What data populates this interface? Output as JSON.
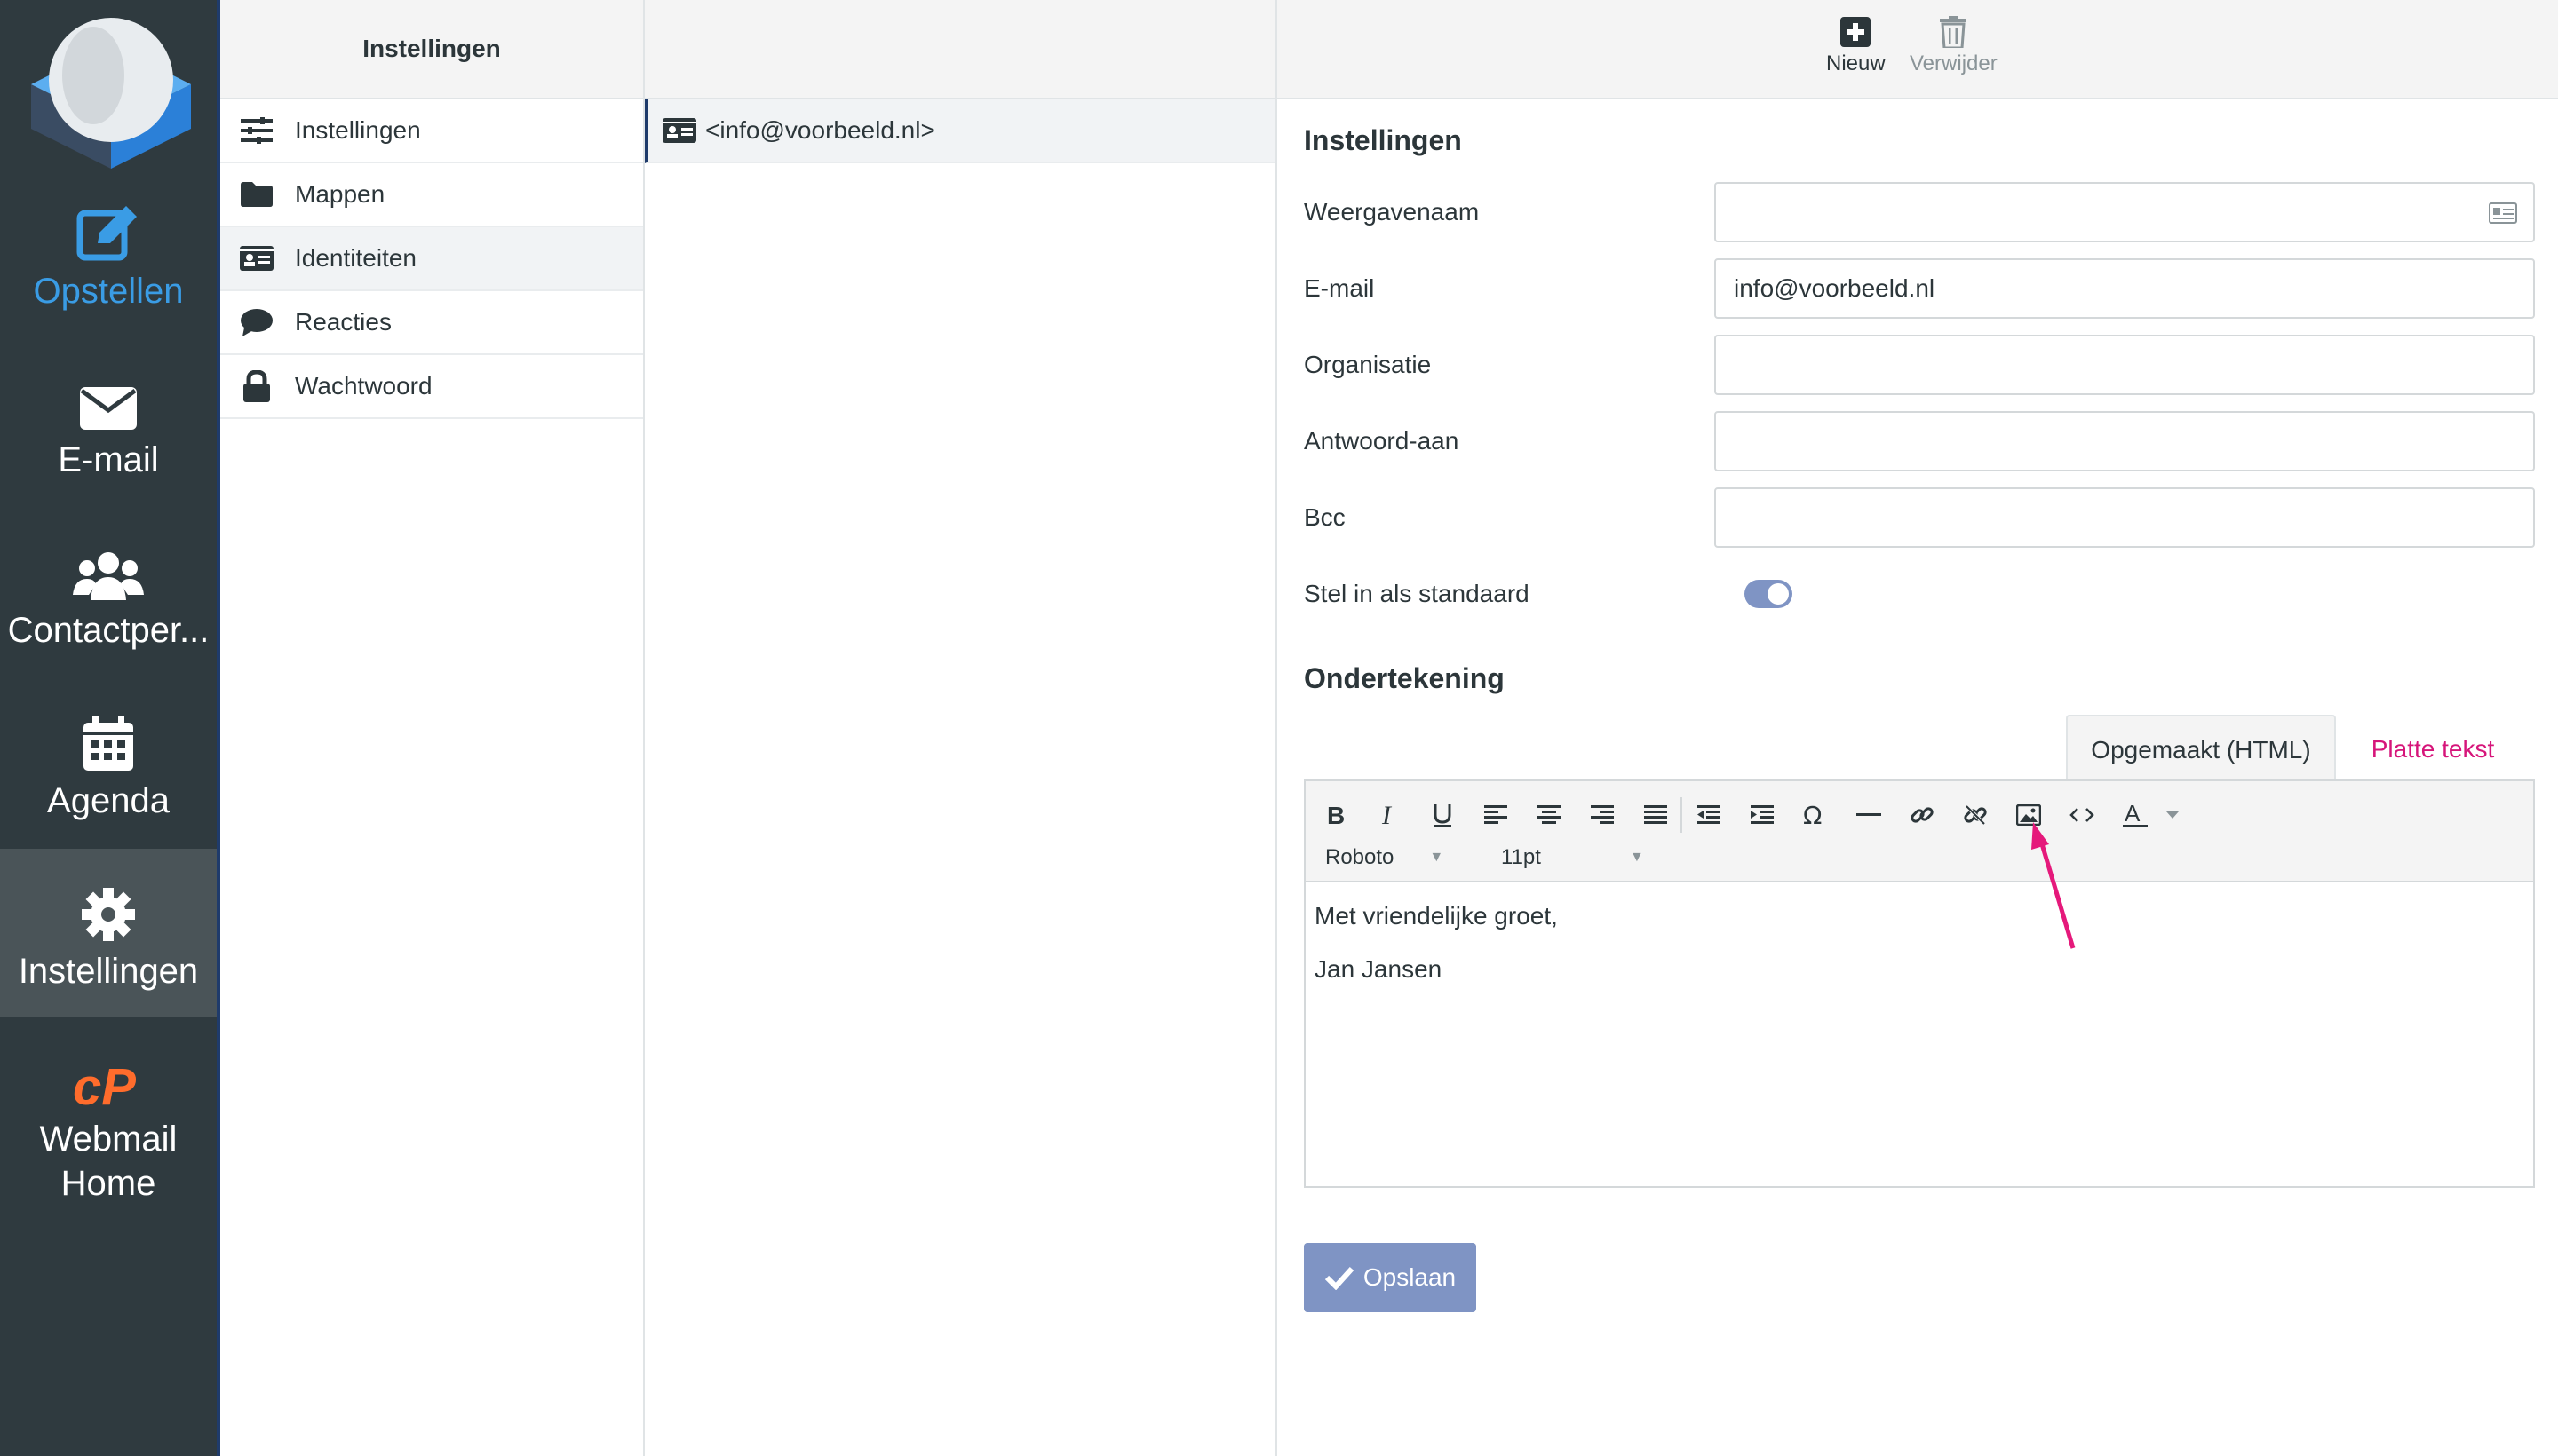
{
  "nav": {
    "items": [
      {
        "label": "Opstellen",
        "icon": "compose-icon"
      },
      {
        "label": "E-mail",
        "icon": "envelope-icon"
      },
      {
        "label": "Contactper...",
        "icon": "users-icon"
      },
      {
        "label": "Agenda",
        "icon": "calendar-icon"
      },
      {
        "label": "Instellingen",
        "icon": "gear-icon"
      },
      {
        "label": "Webmail\nHome",
        "icon": "cpanel-icon"
      }
    ],
    "webmail_line1": "Webmail",
    "webmail_line2": "Home"
  },
  "settings_col": {
    "title": "Instellingen",
    "items": [
      {
        "label": "Instellingen",
        "icon": "sliders-icon"
      },
      {
        "label": "Mappen",
        "icon": "folder-icon"
      },
      {
        "label": "Identiteiten",
        "icon": "id-card-icon"
      },
      {
        "label": "Reacties",
        "icon": "speech-bubble-icon"
      },
      {
        "label": "Wachtwoord",
        "icon": "lock-icon"
      }
    ]
  },
  "identities": {
    "items": [
      {
        "label": "<info@voorbeeld.nl>"
      }
    ]
  },
  "toolbar": {
    "new_label": "Nieuw",
    "delete_label": "Verwijder"
  },
  "form": {
    "section_title": "Instellingen",
    "fields": [
      {
        "label": "Weergavenaam",
        "value": ""
      },
      {
        "label": "E-mail",
        "value": "info@voorbeeld.nl"
      },
      {
        "label": "Organisatie",
        "value": ""
      },
      {
        "label": "Antwoord-aan",
        "value": ""
      },
      {
        "label": "Bcc",
        "value": ""
      }
    ],
    "default_label": "Stel in als standaard",
    "default_on": true
  },
  "signature": {
    "title": "Ondertekening",
    "tab_html": "Opgemaakt (HTML)",
    "tab_plain": "Platte tekst",
    "font": "Roboto",
    "size": "11pt",
    "line1": "Met vriendelijke groet,",
    "line2": "Jan Jansen"
  },
  "save_label": "Opslaan",
  "colors": {
    "accent": "#3a9ce5",
    "pink": "#d6157a",
    "button": "#7f94c4",
    "nav_bg": "#2f3a3f"
  }
}
